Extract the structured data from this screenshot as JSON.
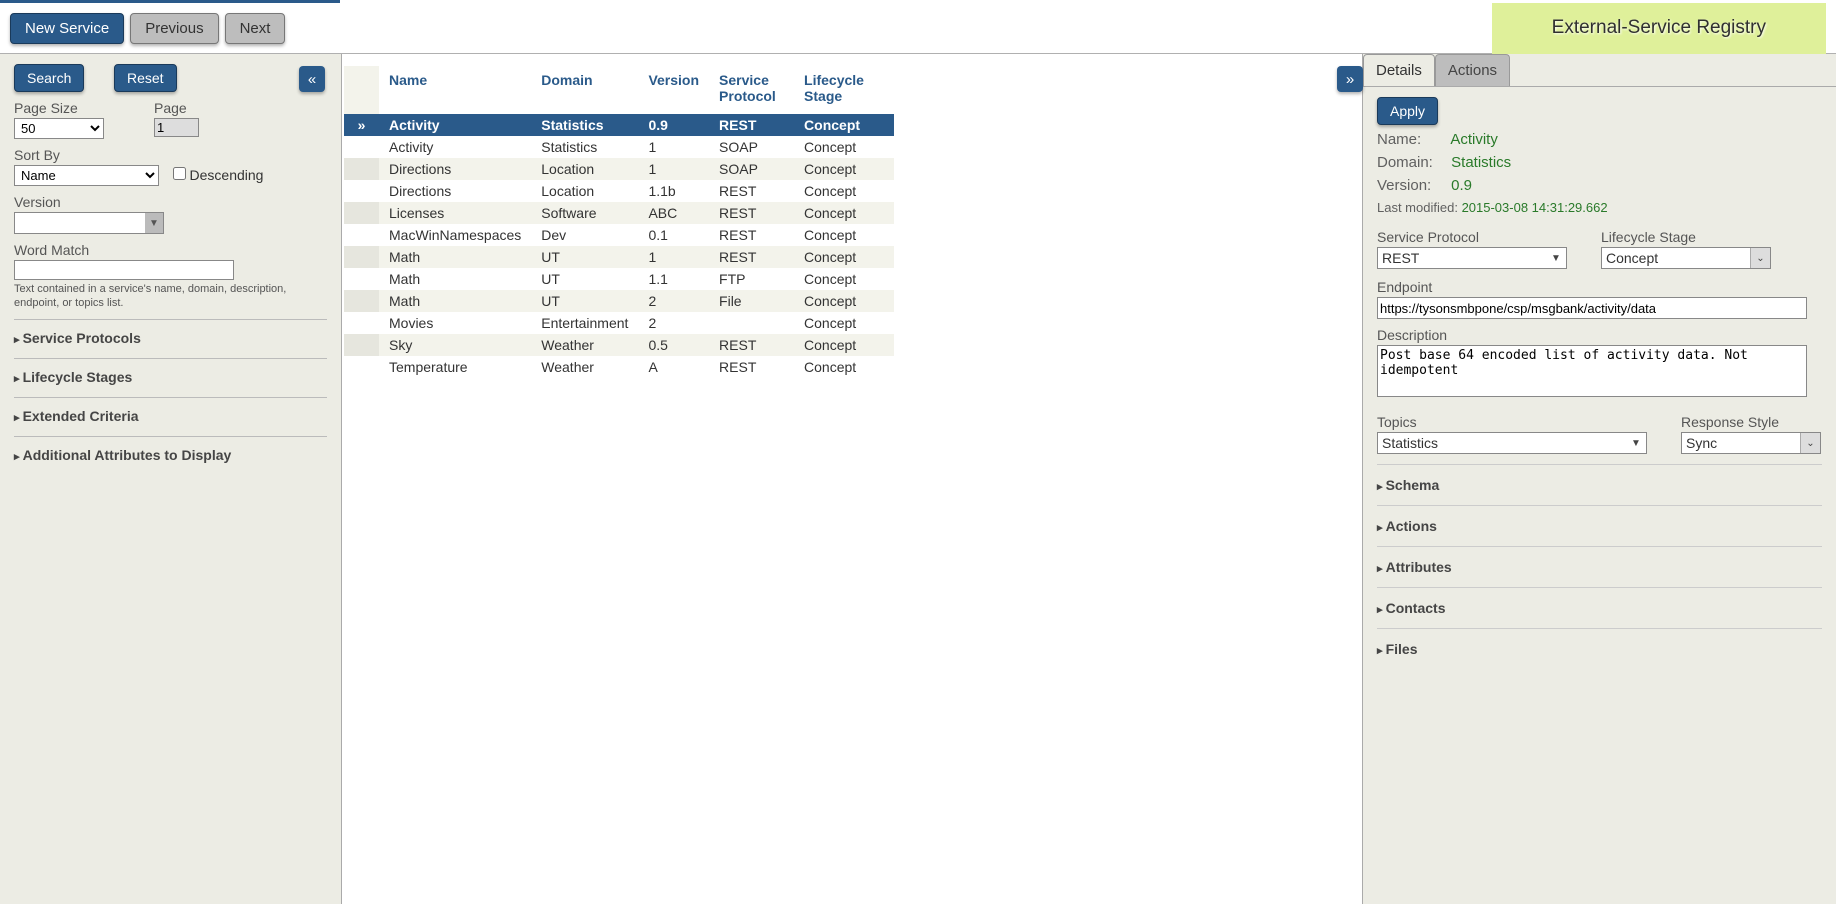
{
  "banner": "External-Service Registry",
  "topbar": {
    "new_service": "New Service",
    "previous": "Previous",
    "next": "Next"
  },
  "left": {
    "search": "Search",
    "reset": "Reset",
    "page_size_label": "Page Size",
    "page_size_value": "50",
    "page_label": "Page",
    "page_value": "1",
    "sortby_label": "Sort By",
    "sortby_value": "Name",
    "descending": "Descending",
    "version_label": "Version",
    "wordmatch_label": "Word Match",
    "wordmatch_help": "Text contained in a service's name, domain, description, endpoint, or topics list.",
    "sections": {
      "protocols": "Service Protocols",
      "stages": "Lifecycle Stages",
      "extended": "Extended Criteria",
      "attrs": "Additional Attributes to Display"
    }
  },
  "table": {
    "headers": {
      "name": "Name",
      "domain": "Domain",
      "version": "Version",
      "protocol": "Service Protocol",
      "stage": "Lifecycle Stage"
    },
    "selected_marker": "»",
    "rows": [
      {
        "name": "Activity",
        "domain": "Statistics",
        "version": "0.9",
        "protocol": "REST",
        "stage": "Concept",
        "sel": true
      },
      {
        "name": "Activity",
        "domain": "Statistics",
        "version": "1",
        "protocol": "SOAP",
        "stage": "Concept"
      },
      {
        "name": "Directions",
        "domain": "Location",
        "version": "1",
        "protocol": "SOAP",
        "stage": "Concept"
      },
      {
        "name": "Directions",
        "domain": "Location",
        "version": "1.1b",
        "protocol": "REST",
        "stage": "Concept"
      },
      {
        "name": "Licenses",
        "domain": "Software",
        "version": "ABC",
        "protocol": "REST",
        "stage": "Concept"
      },
      {
        "name": "MacWinNamespaces",
        "domain": "Dev",
        "version": "0.1",
        "protocol": "REST",
        "stage": "Concept"
      },
      {
        "name": "Math",
        "domain": "UT",
        "version": "1",
        "protocol": "REST",
        "stage": "Concept"
      },
      {
        "name": "Math",
        "domain": "UT",
        "version": "1.1",
        "protocol": "FTP",
        "stage": "Concept"
      },
      {
        "name": "Math",
        "domain": "UT",
        "version": "2",
        "protocol": "File",
        "stage": "Concept"
      },
      {
        "name": "Movies",
        "domain": "Entertainment",
        "version": "2",
        "protocol": "",
        "stage": "Concept"
      },
      {
        "name": "Sky",
        "domain": "Weather",
        "version": "0.5",
        "protocol": "REST",
        "stage": "Concept"
      },
      {
        "name": "Temperature",
        "domain": "Weather",
        "version": "A",
        "protocol": "REST",
        "stage": "Concept"
      }
    ]
  },
  "details": {
    "tab_details": "Details",
    "tab_actions": "Actions",
    "apply": "Apply",
    "name_k": "Name:",
    "name_v": "Activity",
    "domain_k": "Domain:",
    "domain_v": "Statistics",
    "version_k": "Version:",
    "version_v": "0.9",
    "lastmod_k": "Last modified:",
    "lastmod_v": "2015-03-08 14:31:29.662",
    "protocol_label": "Service Protocol",
    "protocol_value": "REST",
    "stage_label": "Lifecycle Stage",
    "stage_value": "Concept",
    "endpoint_label": "Endpoint",
    "endpoint_value": "https://tysonsmbpone/csp/msgbank/activity/data",
    "description_label": "Description",
    "description_value": "Post base 64 encoded list of activity data. Not idempotent",
    "topics_label": "Topics",
    "topics_value": "Statistics",
    "response_label": "Response Style",
    "response_value": "Sync",
    "sections": {
      "schema": "Schema",
      "actions": "Actions",
      "attributes": "Attributes",
      "contacts": "Contacts",
      "files": "Files"
    }
  }
}
